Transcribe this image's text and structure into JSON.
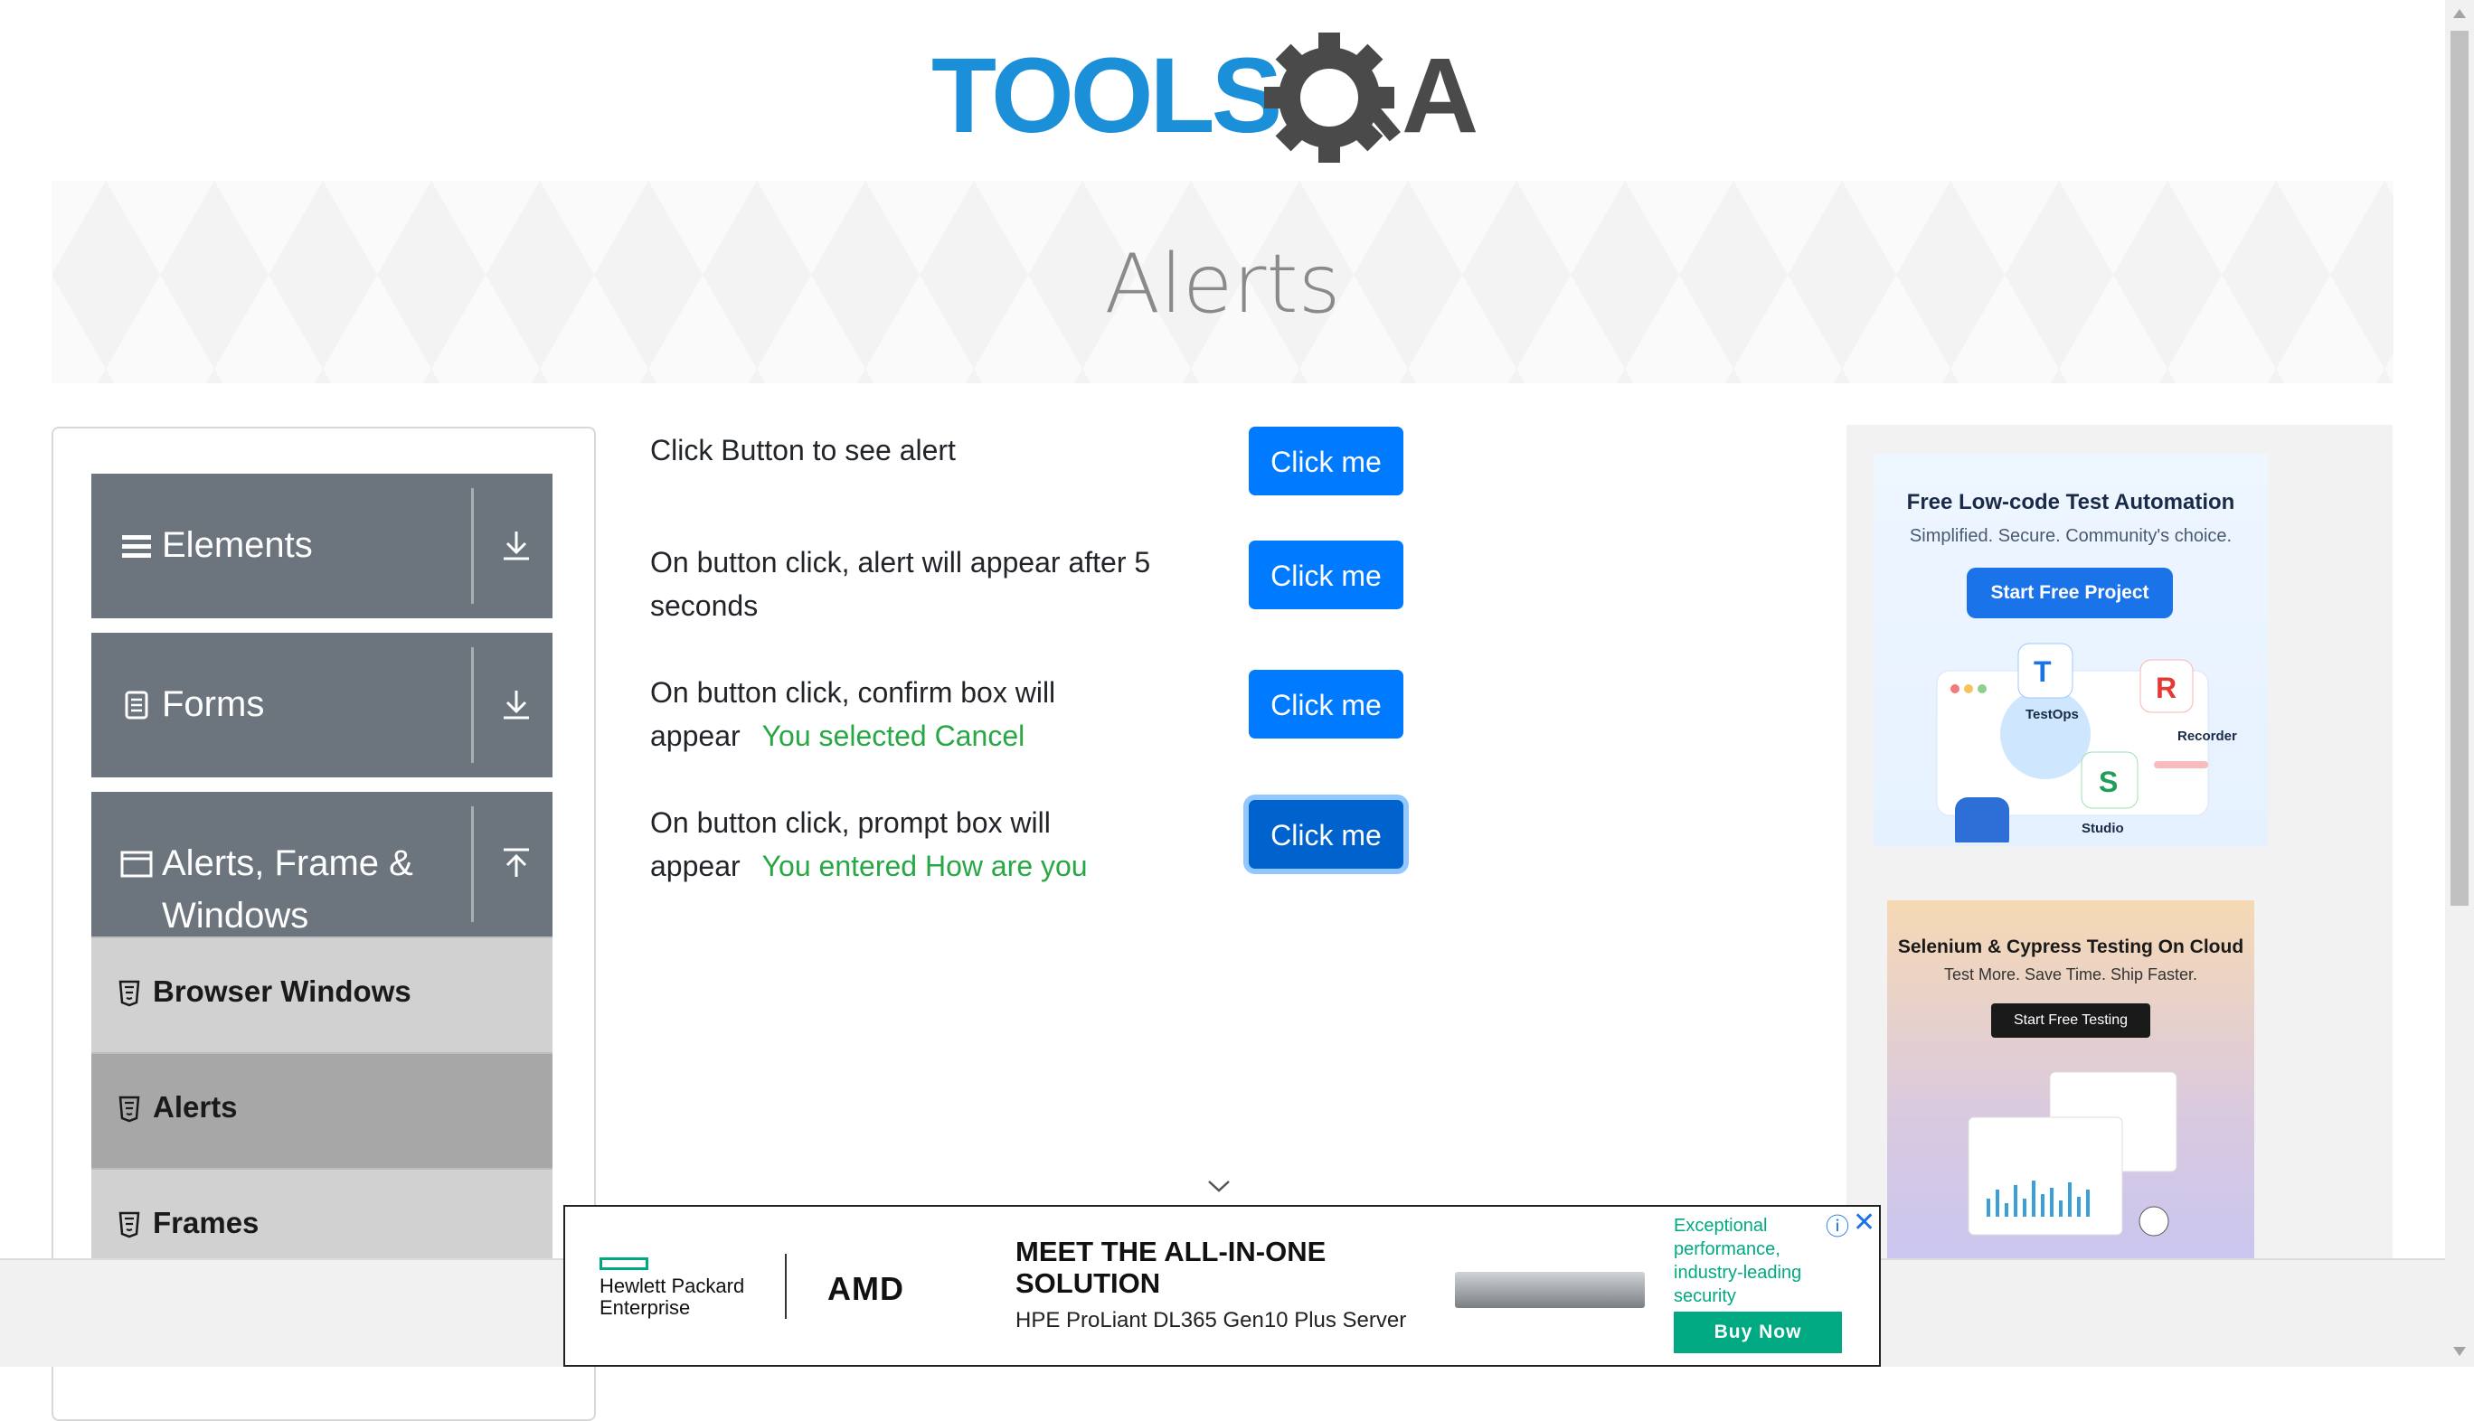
{
  "header": {
    "logo_text_1": "TOOLS",
    "logo_text_2": "A"
  },
  "banner": {
    "title": "Alerts"
  },
  "sidebar": {
    "groups": [
      {
        "label": "Elements",
        "icon": "hamburger-icon",
        "arrow": "download-icon"
      },
      {
        "label": "Forms",
        "icon": "document-icon",
        "arrow": "download-icon"
      },
      {
        "label": "Alerts, Frame & Windows",
        "icon": "window-icon",
        "arrow": "upload-icon"
      }
    ],
    "items": [
      {
        "label": "Browser Windows",
        "icon": "html5-icon"
      },
      {
        "label": "Alerts",
        "icon": "html5-icon",
        "active": true
      },
      {
        "label": "Frames",
        "icon": "html5-icon"
      }
    ]
  },
  "main": {
    "rows": [
      {
        "text": "Click Button to see alert",
        "button": "Click me",
        "result": ""
      },
      {
        "text": "On button click, alert will appear after 5 seconds",
        "button": "Click me",
        "result": ""
      },
      {
        "text": "On button click, confirm box will appear",
        "button": "Click me",
        "result": "You selected Cancel"
      },
      {
        "text": "On button click, prompt box will appear",
        "button": "Click me",
        "result": "You entered How are you"
      }
    ]
  },
  "ads": {
    "ad1": {
      "title": "Free Low-code Test Automation",
      "subtitle": "Simplified. Secure. Community's choice.",
      "cta": "Start Free Project",
      "labels": [
        "TestOps",
        "Recorder",
        "Studio"
      ]
    },
    "ad2": {
      "title": "Selenium & Cypress Testing On Cloud",
      "subtitle": "Test More. Save Time. Ship Faster.",
      "cta": "Start Free Testing"
    },
    "bottom": {
      "brand_1": "Hewlett Packard",
      "brand_2": "Enterprise",
      "brand_3": "AMD",
      "headline": "MEET THE ALL-IN-ONE SOLUTION",
      "sub": "HPE ProLiant DL365 Gen10 Plus Server",
      "desc": "Exceptional performance, industry-leading security",
      "cta": "Buy Now"
    }
  },
  "colors": {
    "primary": "#007bff",
    "success": "#28a745",
    "sidebar_header": "#6c757d",
    "logo_blue": "#1b8fd8",
    "logo_gray": "#4a4a4a"
  }
}
